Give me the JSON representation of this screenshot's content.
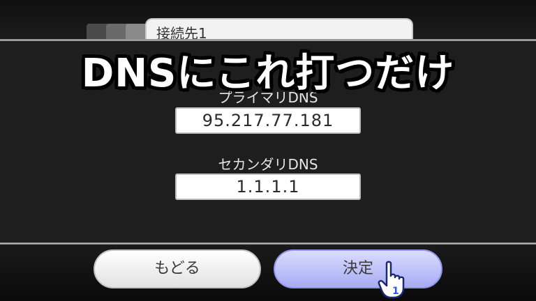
{
  "header": {
    "tab_title": "接続先1"
  },
  "overlay": {
    "caption": "DNSにこれ打つだけ"
  },
  "fields": {
    "primary_label": "プライマリDNS",
    "primary_value": "95.217.77.181",
    "secondary_label": "セカンダリDNS",
    "secondary_value": "1.1.1.1"
  },
  "buttons": {
    "back_label": "もどる",
    "ok_label": "決定"
  },
  "cursor": {
    "player_number": "1"
  },
  "colors": {
    "ok_button": "#a8acf3",
    "back_button": "#e2e2e2",
    "panel": "#1e1e1e"
  }
}
